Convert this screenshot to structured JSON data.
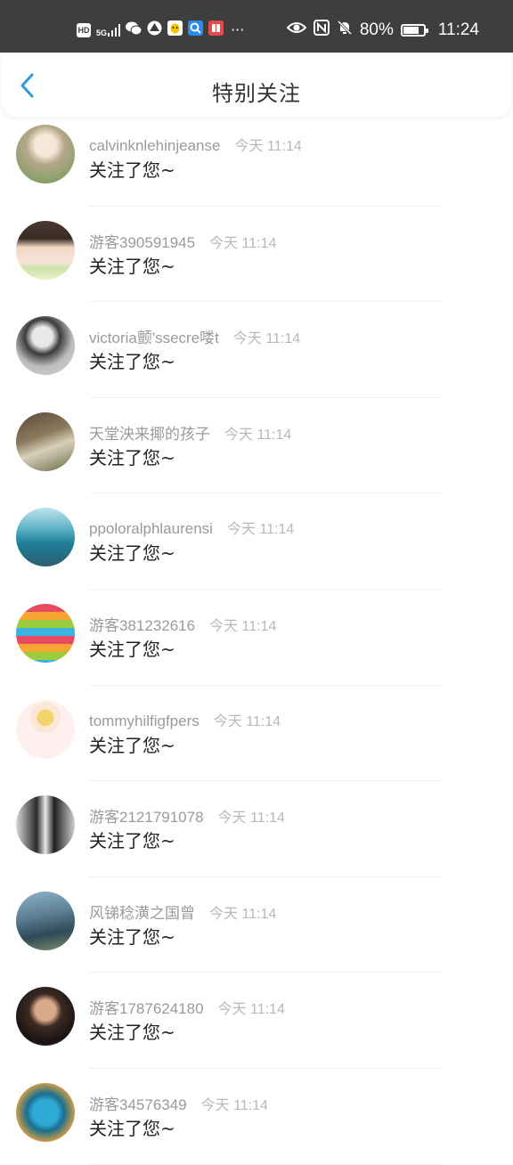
{
  "status_bar": {
    "hd_label": "HD",
    "network_label": "5G",
    "dots": "···",
    "battery_percent": 80,
    "battery_text": "80%",
    "time": "11:24"
  },
  "header": {
    "title": "特别关注",
    "back_icon": "chevron-left-icon",
    "accent_color": "#2b9bde"
  },
  "notifications": [
    {
      "username": "calvinknlehinjeanse",
      "time": "今天 11:14",
      "message": "关注了您~"
    },
    {
      "username": "游客390591945",
      "time": "今天 11:14",
      "message": "关注了您~"
    },
    {
      "username": "victoria颤'ssecre喽t",
      "time": "今天 11:14",
      "message": "关注了您~"
    },
    {
      "username": "天堂泱来揶的孩子",
      "time": "今天 11:14",
      "message": "关注了您~"
    },
    {
      "username": "ppoloralphlaurensi",
      "time": "今天 11:14",
      "message": "关注了您~"
    },
    {
      "username": "游客381232616",
      "time": "今天 11:14",
      "message": "关注了您~"
    },
    {
      "username": "tommyhilfigfpers",
      "time": "今天 11:14",
      "message": "关注了您~"
    },
    {
      "username": "游客2121791078",
      "time": "今天 11:14",
      "message": "关注了您~"
    },
    {
      "username": "风锑稔潢之国曾",
      "time": "今天 11:14",
      "message": "关注了您~"
    },
    {
      "username": "游客1787624180",
      "time": "今天 11:14",
      "message": "关注了您~"
    },
    {
      "username": "游客34576349",
      "time": "今天 11:14",
      "message": "关注了您~"
    }
  ]
}
